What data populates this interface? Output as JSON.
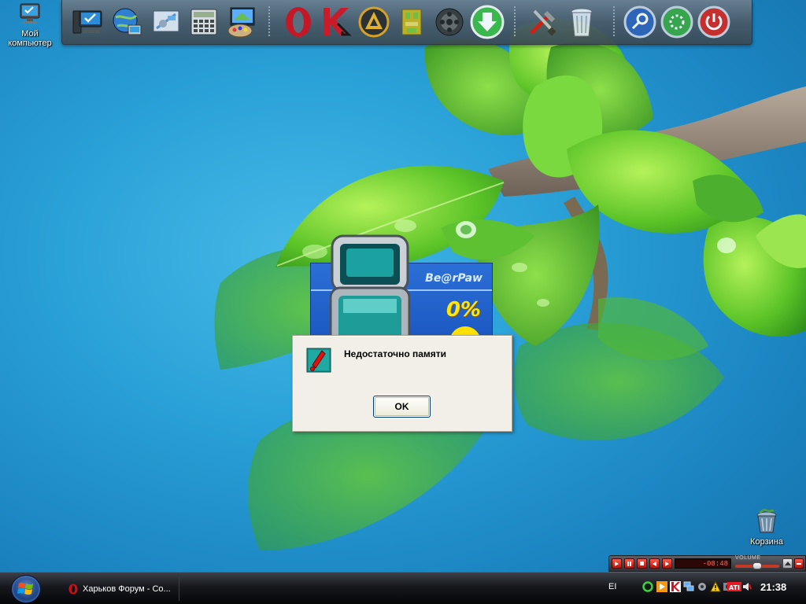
{
  "desktop": {
    "my_computer_label_line1": "Мой",
    "my_computer_label_line2": "компьютер",
    "recycle_bin_label": "Корзина"
  },
  "dock": {
    "icons": [
      "computer-icon",
      "network-globe-icon",
      "control-panel-icon",
      "calculator-icon",
      "paint-icon",
      "opera-icon",
      "kaspersky-icon",
      "aimp-icon",
      "icq-icon",
      "film-reel-icon",
      "download-icon",
      "tools-icon",
      "recycle-bin-icon",
      "search-icon",
      "power-saver-icon",
      "shutdown-icon"
    ]
  },
  "splash": {
    "brand": "Be@rPaw",
    "progress_text": "0%"
  },
  "dialog": {
    "message": "Недостаточно памяти",
    "ok_label": "OK"
  },
  "player": {
    "time": "-08:48",
    "volume_label": "VOLUME",
    "volume_level": 0.5
  },
  "taskbar": {
    "task_opera_label": "Харьков Форум - Co...",
    "language": "EI",
    "clock": "21:38"
  },
  "colors": {
    "wallpaper_blue": "#2aa1d8",
    "leaf_green": "#6fcf3a",
    "player_red": "#c23a28",
    "taskbar_black": "#0b0c0f"
  }
}
